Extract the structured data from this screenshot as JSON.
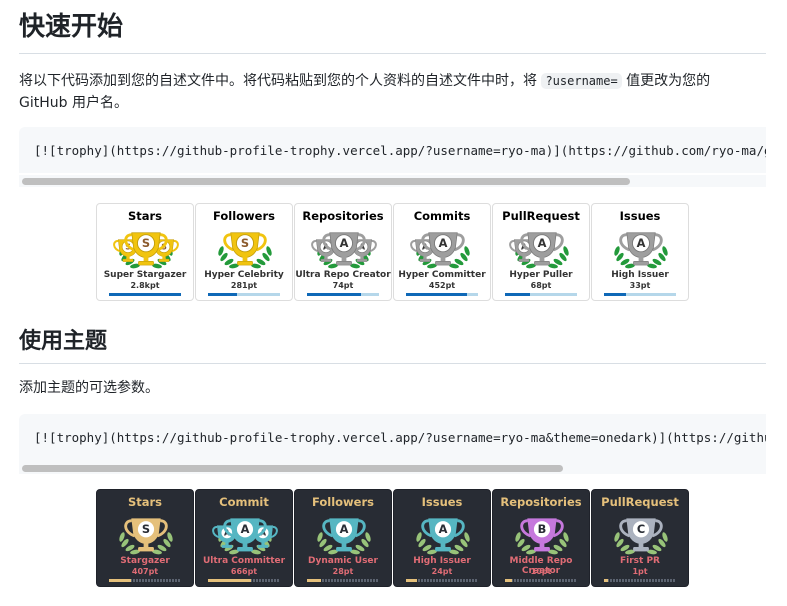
{
  "section1": {
    "heading": "快速开始",
    "para_before": "将以下代码添加到您的自述文件中。将代码粘贴到您的个人资料的自述文件中时，将 ",
    "param": "?username=",
    "para_after": " 值更改为您的 GitHub 用户名。",
    "code": "[![trophy](https://github-profile-trophy.vercel.app/?username=ryo-ma)](https://github.com/ryo-ma/github-profile-trophy)",
    "scroll_fraction": 0.82
  },
  "trophies_light": [
    {
      "title": "Stars",
      "rank": "S",
      "subs": 2,
      "name": "Super Stargazer",
      "points": "2.8kpt",
      "progress": 1.0,
      "color": "gold"
    },
    {
      "title": "Followers",
      "rank": "S",
      "subs": 0,
      "name": "Hyper Celebrity",
      "points": "281pt",
      "progress": 0.4,
      "color": "gold"
    },
    {
      "title": "Repositories",
      "rank": "A",
      "subs": 2,
      "name": "Ultra Repo Creator",
      "points": "74pt",
      "progress": 0.75,
      "color": "silver"
    },
    {
      "title": "Commits",
      "rank": "A",
      "subs": 1,
      "name": "Hyper Committer",
      "points": "452pt",
      "progress": 0.85,
      "color": "silver"
    },
    {
      "title": "PullRequest",
      "rank": "A",
      "subs": 1,
      "name": "Hyper Puller",
      "points": "68pt",
      "progress": 0.35,
      "color": "silver"
    },
    {
      "title": "Issues",
      "rank": "A",
      "subs": 0,
      "name": "High Issuer",
      "points": "33pt",
      "progress": 0.3,
      "color": "silver"
    }
  ],
  "section2": {
    "heading": "使用主题",
    "para": "添加主题的可选参数。",
    "code": "[![trophy](https://github-profile-trophy.vercel.app/?username=ryo-ma&theme=onedark)](https://github.com/ryo-ma/github-profile-trophy)",
    "scroll_fraction": 0.73
  },
  "trophies_dark": [
    {
      "title": "Stars",
      "rank": "S",
      "subs": 0,
      "name": "Stargazer",
      "points": "407pt",
      "progress": 0.3,
      "color": "#e5c07b"
    },
    {
      "title": "Commit",
      "rank": "A",
      "subs": 2,
      "name": "Ultra Committer",
      "points": "666pt",
      "progress": 0.6,
      "color": "#56b6c2"
    },
    {
      "title": "Followers",
      "rank": "A",
      "subs": 0,
      "name": "Dynamic User",
      "points": "28pt",
      "progress": 0.2,
      "color": "#56b6c2"
    },
    {
      "title": "Issues",
      "rank": "A",
      "subs": 0,
      "name": "High Issuer",
      "points": "24pt",
      "progress": 0.15,
      "color": "#56b6c2"
    },
    {
      "title": "Repositories",
      "rank": "B",
      "subs": 0,
      "name": "Middle Repo Creator",
      "points": "10pt",
      "progress": 0.1,
      "color": "#c678dd"
    },
    {
      "title": "PullRequest",
      "rank": "C",
      "subs": 0,
      "name": "First PR",
      "points": "1pt",
      "progress": 0.05,
      "color": "#abb2bf"
    }
  ],
  "colors": {
    "gold": "#f1c40f",
    "silver": "#9e9e9e",
    "laurel_light": "#239a3b",
    "laurel_dark": "#98c379"
  }
}
